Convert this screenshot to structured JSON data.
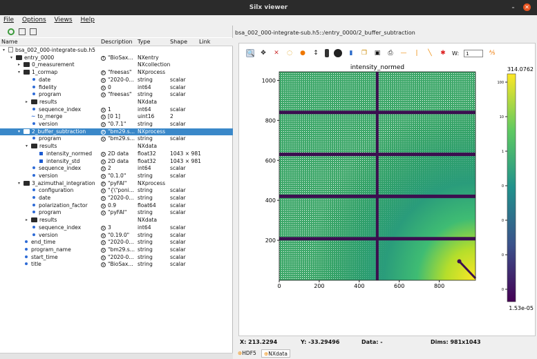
{
  "window": {
    "title": "Silx viewer",
    "minimize": "–",
    "close": "✕"
  },
  "menu": [
    "File",
    "Options",
    "Views",
    "Help"
  ],
  "tree_columns": {
    "name": "Name",
    "description": "Description",
    "type": "Type",
    "shape": "Shape",
    "link": "Link"
  },
  "tree_rows": [
    {
      "arrow": "▾",
      "icon": "file",
      "indent": 0,
      "name": "bsa_002_000-integrate-sub.h5",
      "desc": "",
      "vicon": "",
      "type": "",
      "shape": ""
    },
    {
      "arrow": "▾",
      "icon": "folder",
      "indent": 1,
      "name": "entry_0000",
      "desc": "\"BioSax...",
      "vicon": "T",
      "type": "NXentry",
      "shape": ""
    },
    {
      "arrow": "▸",
      "icon": "folder",
      "indent": 2,
      "name": "0_measurement",
      "desc": "",
      "vicon": "",
      "type": "NXcollection",
      "shape": ""
    },
    {
      "arrow": "▾",
      "icon": "folder",
      "indent": 2,
      "name": "1_cormap",
      "desc": "\"freesas\"",
      "vicon": "P",
      "type": "NXprocess",
      "shape": ""
    },
    {
      "arrow": "",
      "icon": "dot",
      "indent": 3,
      "name": "date",
      "desc": "\"2020-0...",
      "vicon": "V",
      "type": "string",
      "shape": "scalar"
    },
    {
      "arrow": "",
      "icon": "dot",
      "indent": 3,
      "name": "fidelity",
      "desc": "0",
      "vicon": "V",
      "type": "int64",
      "shape": "scalar"
    },
    {
      "arrow": "",
      "icon": "dot",
      "indent": 3,
      "name": "program",
      "desc": "\"freesas\"",
      "vicon": "V",
      "type": "string",
      "shape": "scalar"
    },
    {
      "arrow": "▸",
      "icon": "folder",
      "indent": 3,
      "name": "results",
      "desc": "",
      "vicon": "",
      "type": "NXdata",
      "shape": ""
    },
    {
      "arrow": "",
      "icon": "dot",
      "indent": 3,
      "name": "sequence_index",
      "desc": "1",
      "vicon": "V",
      "type": "int64",
      "shape": "scalar"
    },
    {
      "arrow": "",
      "icon": "tilde",
      "indent": 3,
      "name": "to_merge",
      "desc": "[0 1]",
      "vicon": "V",
      "type": "uint16",
      "shape": "2"
    },
    {
      "arrow": "",
      "icon": "dot",
      "indent": 3,
      "name": "version",
      "desc": "\"0.7.1\"",
      "vicon": "V",
      "type": "string",
      "shape": "scalar"
    },
    {
      "arrow": "▾",
      "icon": "folder",
      "indent": 2,
      "name": "2_buffer_subtraction",
      "desc": "\"bm29.s...",
      "vicon": "P",
      "type": "NXprocess",
      "shape": "",
      "selected": true
    },
    {
      "arrow": "",
      "icon": "dot",
      "indent": 3,
      "name": "program",
      "desc": "\"bm29.s...",
      "vicon": "V",
      "type": "string",
      "shape": "scalar"
    },
    {
      "arrow": "▾",
      "icon": "folder",
      "indent": 3,
      "name": "results",
      "desc": "",
      "vicon": "",
      "type": "NXdata",
      "shape": ""
    },
    {
      "arrow": "",
      "icon": "sq",
      "indent": 4,
      "name": "intensity_normed",
      "desc": "2D data",
      "vicon": "V",
      "type": "float32",
      "shape": "1043 × 981"
    },
    {
      "arrow": "",
      "icon": "sq",
      "indent": 4,
      "name": "intensity_std",
      "desc": "2D data",
      "vicon": "V",
      "type": "float32",
      "shape": "1043 × 981"
    },
    {
      "arrow": "",
      "icon": "dot",
      "indent": 3,
      "name": "sequence_index",
      "desc": "2",
      "vicon": "V",
      "type": "int64",
      "shape": "scalar"
    },
    {
      "arrow": "",
      "icon": "dot",
      "indent": 3,
      "name": "version",
      "desc": "\"0.1.0\"",
      "vicon": "V",
      "type": "string",
      "shape": "scalar"
    },
    {
      "arrow": "▾",
      "icon": "folder",
      "indent": 2,
      "name": "3_azimuthal_integration",
      "desc": "\"pyFAI\"",
      "vicon": "P",
      "type": "NXprocess",
      "shape": ""
    },
    {
      "arrow": "",
      "icon": "dot",
      "indent": 3,
      "name": "configuration",
      "desc": "\"{\\\"poni...",
      "vicon": "V",
      "type": "string",
      "shape": "scalar"
    },
    {
      "arrow": "",
      "icon": "dot",
      "indent": 3,
      "name": "date",
      "desc": "\"2020-0...",
      "vicon": "V",
      "type": "string",
      "shape": "scalar"
    },
    {
      "arrow": "",
      "icon": "dot",
      "indent": 3,
      "name": "polarization_factor",
      "desc": "0.9",
      "vicon": "V",
      "type": "float64",
      "shape": "scalar"
    },
    {
      "arrow": "",
      "icon": "dot",
      "indent": 3,
      "name": "program",
      "desc": "\"pyFAI\"",
      "vicon": "V",
      "type": "string",
      "shape": "scalar"
    },
    {
      "arrow": "▸",
      "icon": "folder",
      "indent": 3,
      "name": "results",
      "desc": "",
      "vicon": "",
      "type": "NXdata",
      "shape": ""
    },
    {
      "arrow": "",
      "icon": "dot",
      "indent": 3,
      "name": "sequence_index",
      "desc": "3",
      "vicon": "V",
      "type": "int64",
      "shape": "scalar"
    },
    {
      "arrow": "",
      "icon": "dot",
      "indent": 3,
      "name": "version",
      "desc": "\"0.19.0\"",
      "vicon": "V",
      "type": "string",
      "shape": "scalar"
    },
    {
      "arrow": "",
      "icon": "dot",
      "indent": 2,
      "name": "end_time",
      "desc": "\"2020-0...",
      "vicon": "V",
      "type": "string",
      "shape": "scalar"
    },
    {
      "arrow": "",
      "icon": "dot",
      "indent": 2,
      "name": "program_name",
      "desc": "\"bm29.s...",
      "vicon": "V",
      "type": "string",
      "shape": "scalar"
    },
    {
      "arrow": "",
      "icon": "dot",
      "indent": 2,
      "name": "start_time",
      "desc": "\"2020-0...",
      "vicon": "V",
      "type": "string",
      "shape": "scalar"
    },
    {
      "arrow": "",
      "icon": "dot",
      "indent": 2,
      "name": "title",
      "desc": "\"BioSax...",
      "vicon": "V",
      "type": "string",
      "shape": "scalar"
    }
  ],
  "viewer": {
    "path": "bsa_002_000-integrate-sub.h5::/entry_0000/2_buffer_subtraction",
    "width_label": "W:",
    "width_value": "1",
    "status": {
      "x": "X: 213.2294",
      "y": "Y: -33.29496",
      "data": "Data: -",
      "dims": "Dims: 981x1043"
    },
    "tabs": [
      "HDF5",
      "NXdata"
    ],
    "toolbar_icons": [
      "zoom-icon",
      "pan-icon",
      "reset-zoom-icon",
      "colormap-icon",
      "aspect-icon",
      "y-axis-icon",
      "keep-aspect-icon",
      "mask-icon",
      "histogram-icon",
      "copy-icon",
      "save-icon",
      "print-icon",
      "hline-icon",
      "vline-icon",
      "line-icon",
      "cross-icon",
      "profile-icon"
    ]
  },
  "chart_data": {
    "type": "heatmap",
    "title": "intensity_normed",
    "xlim": [
      0,
      981
    ],
    "ylim": [
      0,
      1043
    ],
    "xticks": [
      0,
      200,
      400,
      600,
      800
    ],
    "yticks": [
      200,
      400,
      600,
      800,
      1000
    ],
    "gap_columns_x": [
      490
    ],
    "gap_rows_y": [
      208,
      420,
      630,
      840
    ],
    "colorbar": {
      "max": "314.0762",
      "min": "1.53e-05",
      "ticks": [
        "100",
        "10",
        "1",
        "0",
        "0",
        "0",
        "0"
      ],
      "scale": "log",
      "colors": [
        "#440154",
        "#3b528b",
        "#21918c",
        "#5ec962",
        "#fde725"
      ]
    }
  }
}
